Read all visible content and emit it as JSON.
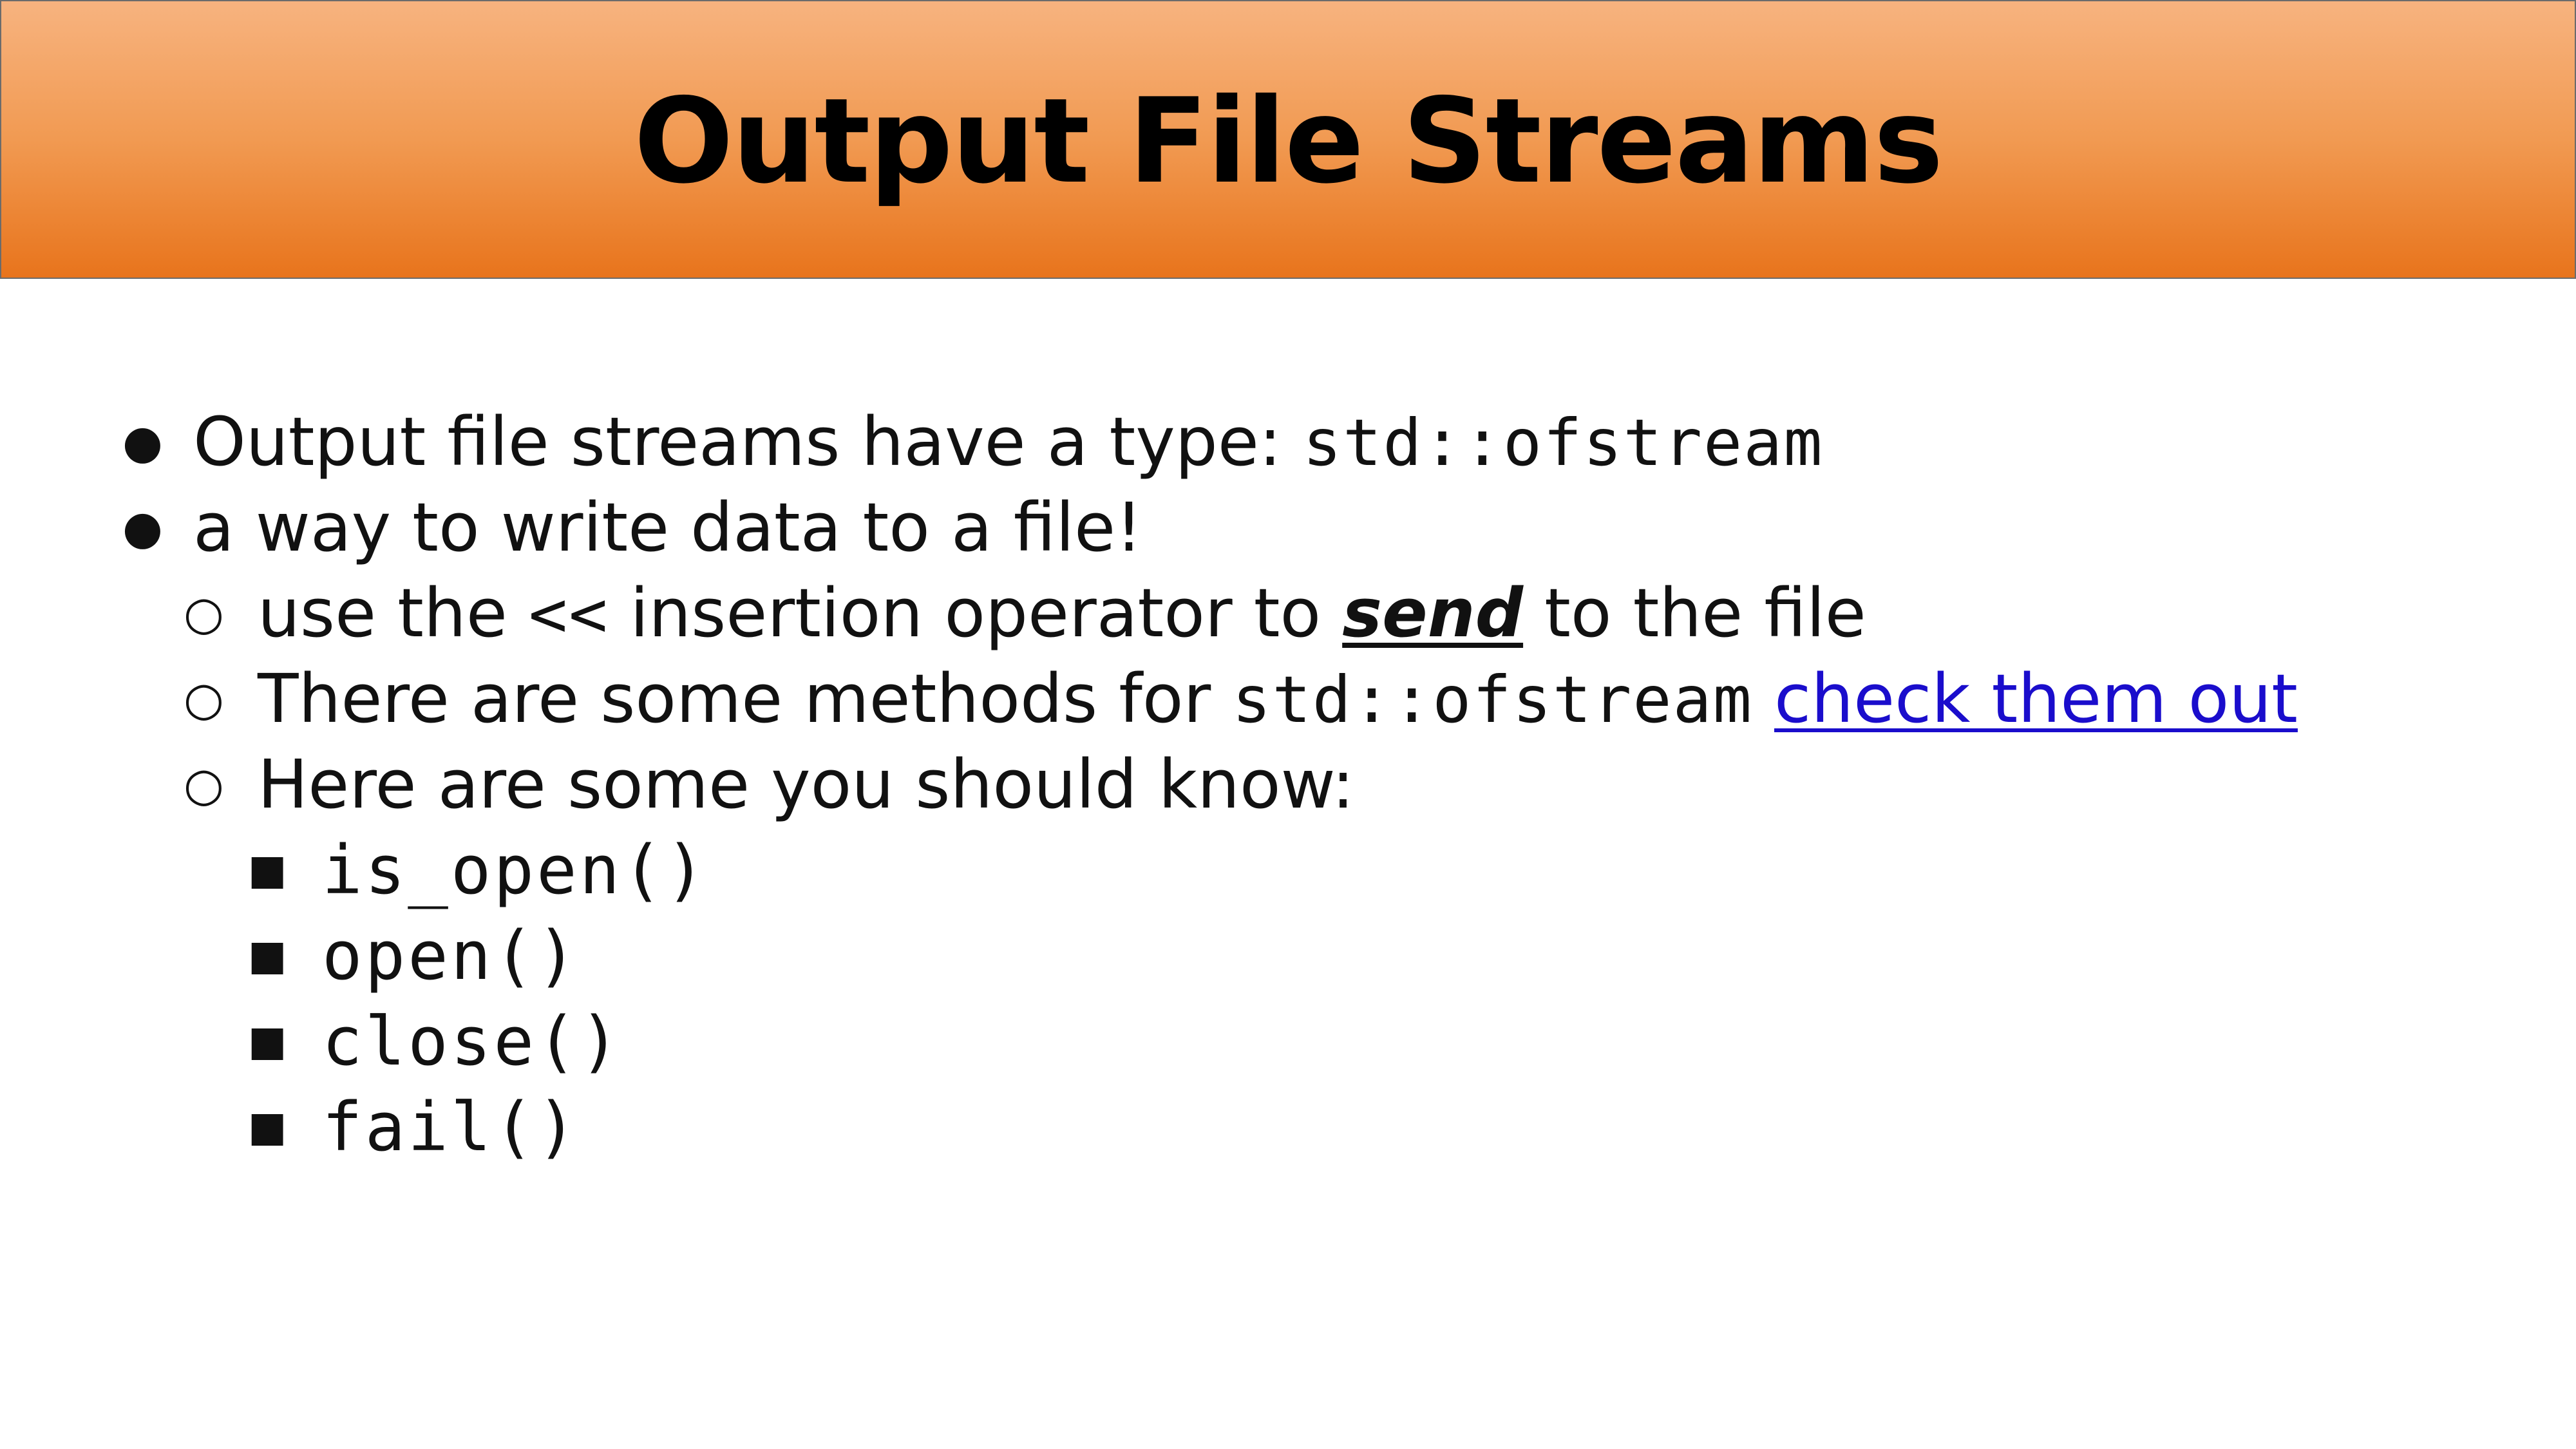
{
  "slide": {
    "title": "Output File Streams"
  },
  "markers": {
    "level1": "●",
    "level2": "○",
    "level3": "■"
  },
  "bullets": {
    "b1": {
      "text": "Output file streams have a type: ",
      "code": "std::ofstream"
    },
    "b2": {
      "text": "a way to write data to a file!"
    },
    "b2_1": {
      "text_a": "use the ",
      "code": "<<",
      "text_b": " insertion operator to ",
      "emph": "send",
      "text_c": " to the file"
    },
    "b2_2": {
      "text_a": "There are some methods for ",
      "code": "std::ofstream",
      "link": "check them out"
    },
    "b2_3": {
      "text": "Here are some you should know:"
    },
    "methods": [
      "is_open()",
      "open()",
      "close()",
      "fail()"
    ]
  },
  "colors": {
    "banner_top": "#f7b37f",
    "banner_bottom": "#e8741c",
    "link": "#1a0dcc",
    "text": "#111111"
  }
}
